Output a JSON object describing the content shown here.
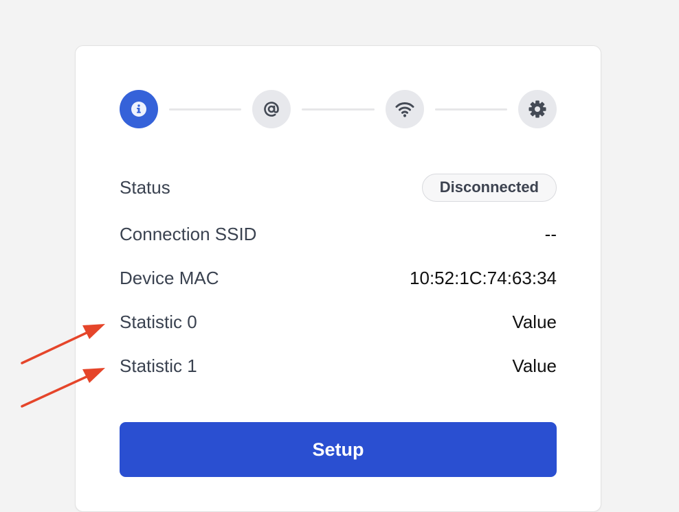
{
  "stepper": {
    "steps": [
      {
        "icon": "info-icon",
        "active": true
      },
      {
        "icon": "at-sign-icon",
        "active": false
      },
      {
        "icon": "wifi-icon",
        "active": false
      },
      {
        "icon": "gear-icon",
        "active": false
      }
    ]
  },
  "details": {
    "status": {
      "label": "Status",
      "value": "Disconnected"
    },
    "ssid": {
      "label": "Connection SSID",
      "value": "--"
    },
    "mac": {
      "label": "Device MAC",
      "value": "10:52:1C:74:63:34"
    },
    "stat0": {
      "label": "Statistic 0",
      "value": "Value"
    },
    "stat1": {
      "label": "Statistic 1",
      "value": "Value"
    }
  },
  "actions": {
    "setup_label": "Setup"
  },
  "colors": {
    "accent": "#2a4fd1",
    "active_step": "#3562d9",
    "inactive_step": "#e7e8ec",
    "annotation_arrow": "#e5452a",
    "background": "#f3f3f3"
  }
}
